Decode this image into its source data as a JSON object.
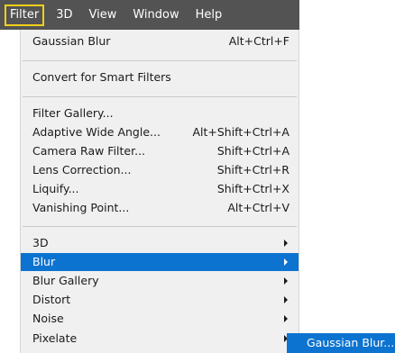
{
  "menubar": {
    "items": [
      "Filter",
      "3D",
      "View",
      "Window",
      "Help"
    ]
  },
  "filter_menu": {
    "items": [
      {
        "label": "Gaussian Blur",
        "shortcut": "Alt+Ctrl+F"
      },
      {
        "label": "Convert for Smart Filters"
      },
      {
        "label": "Filter Gallery..."
      },
      {
        "label": "Adaptive Wide Angle...",
        "shortcut": "Alt+Shift+Ctrl+A"
      },
      {
        "label": "Camera Raw Filter...",
        "shortcut": "Shift+Ctrl+A"
      },
      {
        "label": "Lens Correction...",
        "shortcut": "Shift+Ctrl+R"
      },
      {
        "label": "Liquify...",
        "shortcut": "Shift+Ctrl+X"
      },
      {
        "label": "Vanishing Point...",
        "shortcut": "Alt+Ctrl+V"
      },
      {
        "label": "3D"
      },
      {
        "label": "Blur"
      },
      {
        "label": "Blur Gallery"
      },
      {
        "label": "Distort"
      },
      {
        "label": "Noise"
      },
      {
        "label": "Pixelate"
      }
    ]
  },
  "blur_submenu": {
    "items": [
      "Gaussian Blur..."
    ]
  },
  "colors": {
    "menubar_bg": "#535353",
    "active_outline": "#f2cf1a",
    "highlight": "#0d73d0"
  }
}
